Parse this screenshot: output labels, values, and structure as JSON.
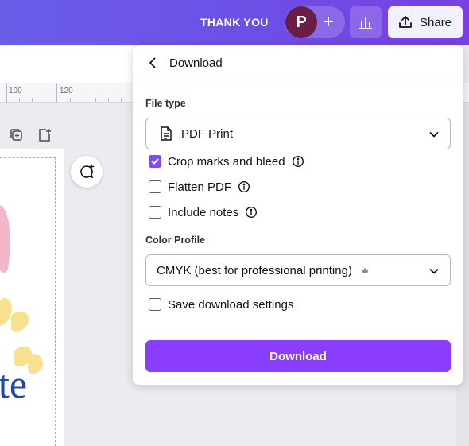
{
  "topbar": {
    "title": "THANK YOU",
    "avatar_initial": "P",
    "add_symbol": "+",
    "share_label": "Share",
    "colors": {
      "gradient_start": "#6a5ee8",
      "gradient_end": "#7a3fe2",
      "avatar_bg": "#6c1d45"
    },
    "icons": {
      "add": "plus-icon",
      "insights": "bar-chart-icon",
      "share": "share-upload-icon"
    }
  },
  "ruler": {
    "labels": [
      "100",
      "120"
    ]
  },
  "canvas": {
    "visible_text": "te",
    "icons": [
      "duplicate-page-icon",
      "add-page-icon",
      "add-comment-icon"
    ]
  },
  "panel": {
    "title": "Download",
    "file_type": {
      "label": "File type",
      "value": "PDF Print",
      "icon": "document-icon"
    },
    "options": [
      {
        "label": "Crop marks and bleed",
        "checked": true,
        "has_info": true
      },
      {
        "label": "Flatten PDF",
        "checked": false,
        "has_info": true
      },
      {
        "label": "Include notes",
        "checked": false,
        "has_info": true
      }
    ],
    "color_profile": {
      "label": "Color Profile",
      "value": "CMYK (best for professional printing)",
      "badge_icon": "crown-icon"
    },
    "save_settings": {
      "label": "Save download settings",
      "checked": false
    },
    "download_button": "Download",
    "colors": {
      "accent": "#8b3dff",
      "checkbox_checked": "#7d4cf5"
    }
  }
}
